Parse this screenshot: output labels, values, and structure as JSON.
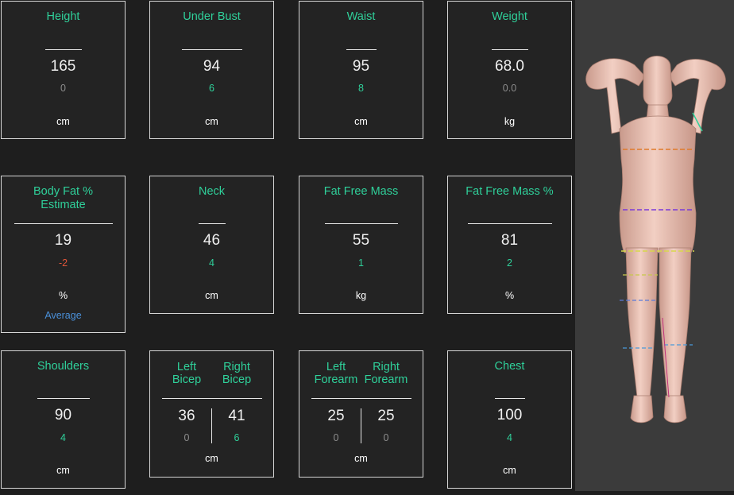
{
  "colors": {
    "accent": "#2fd09a",
    "neutral_delta": "#8c8c8c",
    "positive_delta": "#2fd09a",
    "negative_delta": "#e0553a",
    "note": "#4a90d9"
  },
  "cards": {
    "height": {
      "title": "Height",
      "value": "165",
      "delta": "0",
      "unit": "cm"
    },
    "under_bust": {
      "title": "Under Bust",
      "value": "94",
      "delta": "6",
      "unit": "cm"
    },
    "waist": {
      "title": "Waist",
      "value": "95",
      "delta": "8",
      "unit": "cm"
    },
    "weight": {
      "title": "Weight",
      "value": "68.0",
      "delta": "0.0",
      "unit": "kg"
    },
    "body_fat": {
      "title_line1": "Body Fat %",
      "title_line2": "Estimate",
      "value": "19",
      "delta": "-2",
      "unit": "%",
      "note": "Average"
    },
    "neck": {
      "title": "Neck",
      "value": "46",
      "delta": "4",
      "unit": "cm"
    },
    "fat_free_mass": {
      "title": "Fat Free Mass",
      "value": "55",
      "delta": "1",
      "unit": "kg"
    },
    "fat_free_mass_pct": {
      "title": "Fat Free Mass %",
      "value": "81",
      "delta": "2",
      "unit": "%"
    },
    "shoulders": {
      "title": "Shoulders",
      "value": "90",
      "delta": "4",
      "unit": "cm"
    },
    "biceps": {
      "left_title_1": "Left",
      "left_title_2": "Bicep",
      "left_value": "36",
      "left_delta": "0",
      "right_title_1": "Right",
      "right_title_2": "Bicep",
      "right_value": "41",
      "right_delta": "6",
      "unit": "cm"
    },
    "forearms": {
      "left_title_1": "Left",
      "left_title_2": "Forearm",
      "left_value": "25",
      "left_delta": "0",
      "right_title_1": "Right",
      "right_title_2": "Forearm",
      "right_value": "25",
      "right_delta": "0",
      "unit": "cm"
    },
    "chest": {
      "title": "Chest",
      "value": "100",
      "delta": "4",
      "unit": "cm"
    }
  }
}
